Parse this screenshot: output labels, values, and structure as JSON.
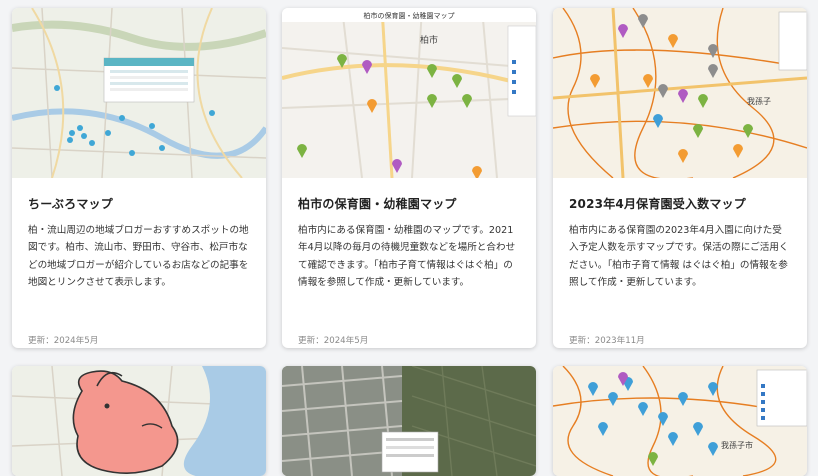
{
  "cards": [
    {
      "title": "ちーぶろマップ",
      "description": "柏・流山周辺の地域ブロガーおすすめスポットの地図です。柏市、流山市、野田市、守谷市、松戸市などの地域ブロガーが紹介しているお店などの記事を地図とリンクさせて表示します。",
      "updated": "更新：2024年5月",
      "thumbnail": "map-with-blog-markers"
    },
    {
      "title": "柏市の保育園・幼稚園マップ",
      "description": "柏市内にある保育園・幼稚園のマップです。2021年4月以降の毎月の待機児童数などを場所と合わせて確認できます。「柏市子育て情報はぐはぐ柏」の情報を参照して作成・更新しています。",
      "updated": "更新：2024年5月",
      "thumbnail": "nursery-map",
      "map_label": "柏市の保育園・幼稚園マップ",
      "map_city": "柏市"
    },
    {
      "title": "2023年4月保育園受入数マップ",
      "description": "柏市内にある保育園の2023年4月入園に向けた受入予定人数を示すマップです。保活の際にご活用ください。「柏市子育て情報 はぐはぐ柏」の情報を参照して作成・更新しています。",
      "updated": "更新：2023年11月",
      "thumbnail": "capacity-map",
      "map_city": "我孫子"
    },
    {
      "thumbnail": "mascot-map"
    },
    {
      "thumbnail": "aerial-photo"
    },
    {
      "thumbnail": "capacity-map-2",
      "map_city": "我孫子市"
    }
  ],
  "colors": {
    "pin_orange": "#f39c33",
    "pin_green": "#7cb342",
    "pin_purple": "#b05bc2",
    "pin_gray": "#8d8d8d",
    "pin_blue": "#3f9fd8",
    "boundary": "#e67e22"
  }
}
